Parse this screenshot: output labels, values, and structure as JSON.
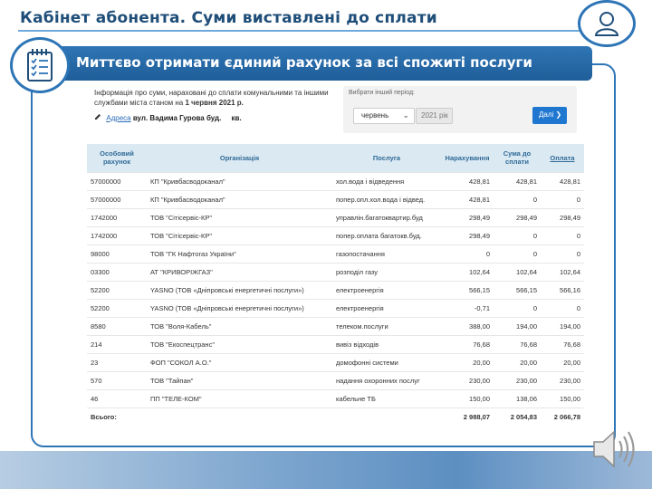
{
  "slide": {
    "title": "Кабінет абонента. Суми виставлені до сплати",
    "banner": "Миттєво отримати єдиний рахунок за всі спожиті послуги"
  },
  "info": {
    "text": "Інформація про суми, нараховані до сплати комунальними та іншими службами міста станом на",
    "date": "1 червня 2021 р.",
    "address_label": "Адреса",
    "street": "вул. Вадима Гурова буд.",
    "apt_label": "кв."
  },
  "period": {
    "label": "Вибрати інший період:",
    "month": "червень",
    "year": "2021 рік",
    "next_button": "Далі"
  },
  "table": {
    "headers": [
      "Особовий рахунок",
      "Організація",
      "Послуга",
      "Нарахування",
      "Сума до сплати",
      "Оплата"
    ],
    "rows": [
      [
        "57000000",
        "КП \"Кривбасводоканал\"",
        "хол.вода і відведення",
        "428,81",
        "428,81",
        "428,81"
      ],
      [
        "57000000",
        "КП \"Кривбасводоканал\"",
        "попер.опл.хол.вода і відвед.",
        "428,81",
        "0",
        "0"
      ],
      [
        "1742000",
        "ТОВ \"Сітісервіс-КР\"",
        "управлін.багатоквартир.буд",
        "298,49",
        "298,49",
        "298,49"
      ],
      [
        "1742000",
        "ТОВ \"Сітісервіс-КР\"",
        "попер.оплата багатокв.буд.",
        "298,49",
        "0",
        "0"
      ],
      [
        "98000",
        "ТОВ \"ГК Нафтогаз України\"",
        "газопостачання",
        "0",
        "0",
        "0"
      ],
      [
        "03300",
        "АТ \"КРИВОРІЖГАЗ\"",
        "розподіл газу",
        "102,64",
        "102,64",
        "102,64"
      ],
      [
        "52200",
        "YASNO (ТОВ «Дніпровські енергетичні послуги»)",
        "електроенергія",
        "566,15",
        "566,15",
        "566,16"
      ],
      [
        "52200",
        "YASNO (ТОВ «Дніпровські енергетичні послуги»)",
        "електроенергія",
        "-0,71",
        "0",
        "0"
      ],
      [
        "8580",
        "ТОВ \"Воля-Кабель\"",
        "телеком.послуги",
        "388,00",
        "194,00",
        "194,00"
      ],
      [
        "214",
        "ТОВ \"Екоспецтранс\"",
        "вивіз відходів",
        "76,68",
        "76,68",
        "76,68"
      ],
      [
        "23",
        "ФОП \"СОКОЛ А.О.\"",
        "домофонні системи",
        "20,00",
        "20,00",
        "20,00"
      ],
      [
        "570",
        "ТОВ \"Тайпан\"",
        "надання охоронних послуг",
        "230,00",
        "230,00",
        "230,00"
      ],
      [
        "46",
        "ПП \"ТЕЛЕ-КОМ\"",
        "кабельне ТБ",
        "150,00",
        "138,06",
        "150,00"
      ]
    ],
    "total": [
      "Всього:",
      "",
      "",
      "2 988,07",
      "2 054,83",
      "2 066,78"
    ]
  },
  "icons": [
    "user-icon",
    "checklist-icon",
    "speaker-icon",
    "edit-icon",
    "chevron-down-icon",
    "chevron-right-icon"
  ],
  "colors": {
    "accent": "#2e75b6",
    "title": "#1f4e79",
    "banner": "#2f75b5",
    "button": "#1f77d0",
    "table_header": "#dbe9f3"
  }
}
